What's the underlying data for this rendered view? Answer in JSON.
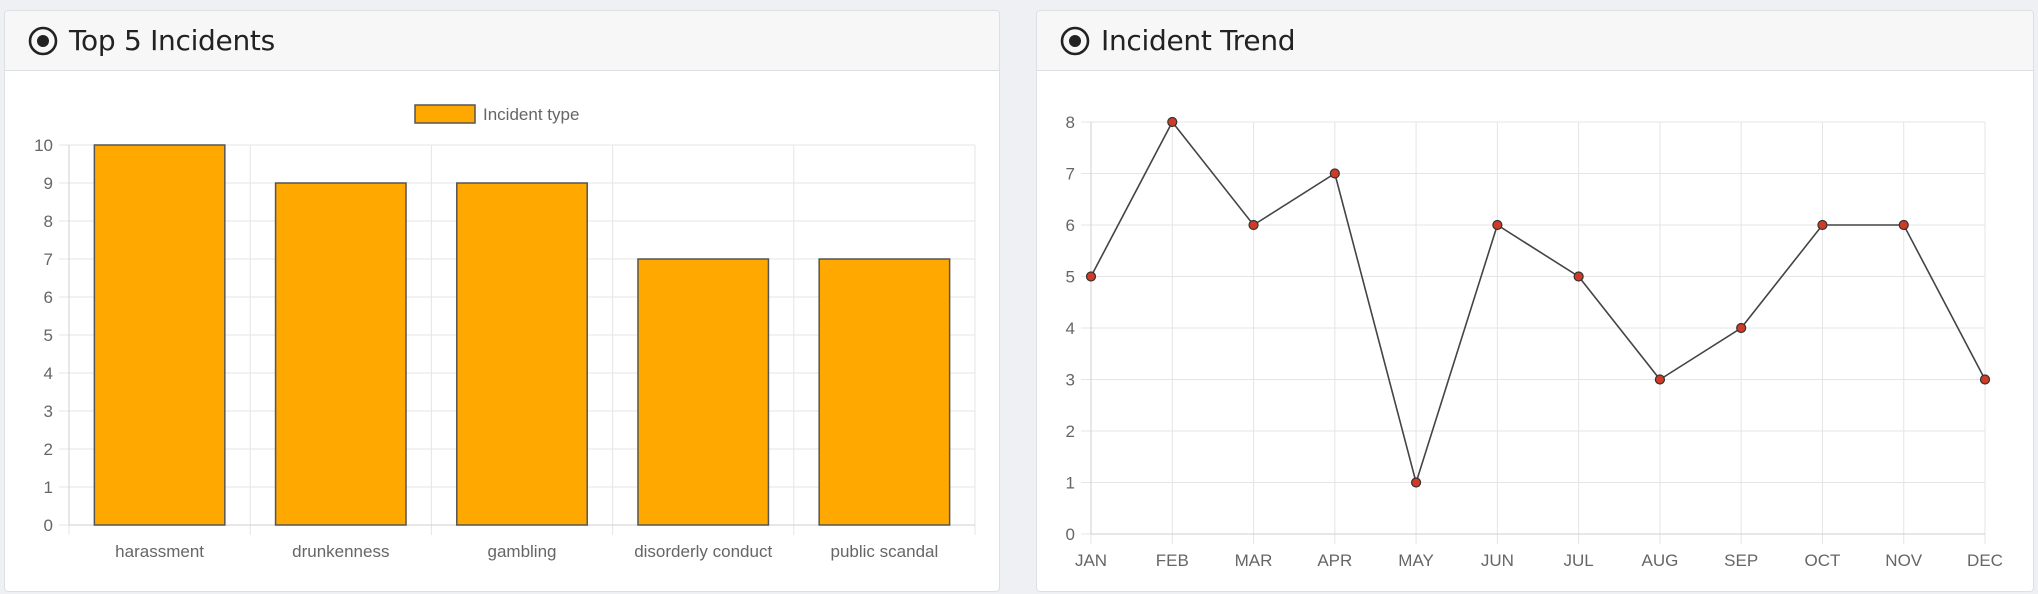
{
  "cards": {
    "left": {
      "title": "Top 5 Incidents",
      "icon": "record-circle-icon"
    },
    "right": {
      "title": "Incident Trend",
      "icon": "record-circle-icon"
    }
  },
  "colors": {
    "bar_fill": "#ffa800",
    "bar_border": "#555555",
    "line": "#444444",
    "point": "#d03b27",
    "grid": "#e5e5e5"
  },
  "chart_data": [
    {
      "type": "bar",
      "categories": [
        "harassment",
        "drunkenness",
        "gambling",
        "disorderly conduct",
        "public scandal"
      ],
      "series": [
        {
          "name": "Incident type",
          "values": [
            10,
            9,
            9,
            7,
            7
          ]
        }
      ],
      "title": "",
      "xlabel": "",
      "ylabel": "",
      "ylim": [
        0,
        10
      ],
      "yticks": [
        0,
        1,
        2,
        3,
        4,
        5,
        6,
        7,
        8,
        9,
        10
      ],
      "grid": true,
      "legend": "top-center"
    },
    {
      "type": "line",
      "categories": [
        "JAN",
        "FEB",
        "MAR",
        "APR",
        "MAY",
        "JUN",
        "JUL",
        "AUG",
        "SEP",
        "OCT",
        "NOV",
        "DEC"
      ],
      "series": [
        {
          "values": [
            5,
            8,
            6,
            7,
            1,
            6,
            5,
            3,
            4,
            6,
            6,
            3
          ]
        }
      ],
      "title": "",
      "xlabel": "",
      "ylabel": "",
      "ylim": [
        0,
        8
      ],
      "yticks": [
        0,
        1,
        2,
        3,
        4,
        5,
        6,
        7,
        8
      ],
      "grid": true,
      "legend": "none"
    }
  ]
}
